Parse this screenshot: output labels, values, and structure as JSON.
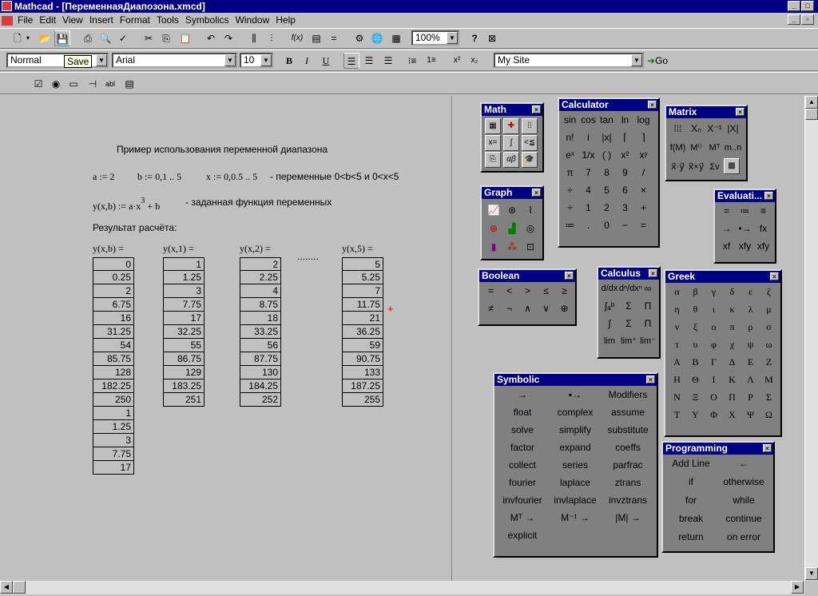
{
  "window": {
    "title": "Mathcad - [ПеременнаяДиапозона.xmcd]",
    "min": "_",
    "max": "□",
    "close": "×"
  },
  "menu": [
    "File",
    "Edit",
    "View",
    "Insert",
    "Format",
    "Tools",
    "Symbolics",
    "Window",
    "Help"
  ],
  "toolbar": {
    "zoom": "100%",
    "save_tooltip": "Save"
  },
  "format_bar": {
    "style": "Normal",
    "font": "Arial",
    "size": "10",
    "bold": "B",
    "italic": "I",
    "underline": "U",
    "url": "My Site",
    "go": "Go"
  },
  "worksheet": {
    "heading": "Пример использования переменной диапазона",
    "defs": {
      "a": "a := 2",
      "b": "b := 0,1 .. 5",
      "x": "x := 0,0.5 .. 5",
      "note": "- переменные 0<b<5 и 0<x<5"
    },
    "func": {
      "lhs": "y(x,b) := a·x",
      "exp": "3",
      "rhs": "+ b",
      "note": "- заданная функция переменных"
    },
    "result_label": "Результат расчёта:",
    "dots": "........",
    "columns": [
      {
        "header": "y(x,b) =",
        "values": [
          "0",
          "0.25",
          "2",
          "6.75",
          "16",
          "31.25",
          "54",
          "85.75",
          "128",
          "182.25",
          "250",
          "1",
          "1.25",
          "3",
          "7.75",
          "17"
        ]
      },
      {
        "header": "y(x,1) =",
        "values": [
          "1",
          "1.25",
          "3",
          "7.75",
          "17",
          "32.25",
          "55",
          "86.75",
          "129",
          "183.25",
          "251"
        ]
      },
      {
        "header": "y(x,2) =",
        "values": [
          "2",
          "2.25",
          "4",
          "8.75",
          "18",
          "33.25",
          "56",
          "87.75",
          "130",
          "184.25",
          "252"
        ]
      },
      {
        "header": "y(x,5) =",
        "values": [
          "5",
          "5.25",
          "7",
          "11.75",
          "21",
          "36.25",
          "59",
          "90.75",
          "133",
          "187.25",
          "255"
        ]
      }
    ]
  },
  "palettes": {
    "math": {
      "title": "Math"
    },
    "calculator": {
      "title": "Calculator",
      "keys": [
        "sin",
        "cos",
        "tan",
        "ln",
        "log",
        "n!",
        "i",
        "|x|",
        "⌈",
        "⌉",
        "eˣ",
        "1/x",
        "( )",
        "x²",
        "xʸ",
        "π",
        "7",
        "8",
        "9",
        "/",
        "÷",
        "4",
        "5",
        "6",
        "×",
        "÷",
        "1",
        "2",
        "3",
        "+",
        "≔",
        ".",
        "0",
        "−",
        "="
      ]
    },
    "matrix": {
      "title": "Matrix"
    },
    "graph": {
      "title": "Graph"
    },
    "evaluation": {
      "title": "Evaluati...",
      "keys": [
        "=",
        "≔",
        "≡",
        "→",
        "•→",
        "fx",
        "xf",
        "xfy",
        "xfy"
      ]
    },
    "boolean": {
      "title": "Boolean",
      "keys": [
        "=",
        "<",
        ">",
        "≤",
        "≥",
        "≠",
        "¬",
        "∧",
        "∨",
        "⊕"
      ]
    },
    "calculus": {
      "title": "Calculus"
    },
    "greek": {
      "title": "Greek",
      "keys": [
        "α",
        "β",
        "γ",
        "δ",
        "ε",
        "ζ",
        "η",
        "θ",
        "ι",
        "κ",
        "λ",
        "μ",
        "ν",
        "ξ",
        "ο",
        "π",
        "ρ",
        "σ",
        "τ",
        "υ",
        "φ",
        "χ",
        "ψ",
        "ω",
        "Α",
        "Β",
        "Γ",
        "Δ",
        "Ε",
        "Ζ",
        "Η",
        "Θ",
        "Ι",
        "Κ",
        "Λ",
        "Μ",
        "Ν",
        "Ξ",
        "Ο",
        "Π",
        "Ρ",
        "Σ",
        "Τ",
        "Υ",
        "Φ",
        "Χ",
        "Ψ",
        "Ω"
      ]
    },
    "symbolic": {
      "title": "Symbolic",
      "keys": [
        "→",
        "▪→",
        "Modifiers",
        "float",
        "complex",
        "assume",
        "solve",
        "simplify",
        "substitute",
        "factor",
        "expand",
        "coeffs",
        "collect",
        "series",
        "parfrac",
        "fourier",
        "laplace",
        "ztrans",
        "invfourier",
        "invlaplace",
        "invztrans",
        "Mᵀ →",
        "M⁻¹ →",
        "|M| →",
        "explicit",
        "",
        ""
      ]
    },
    "programming": {
      "title": "Programming",
      "keys": [
        "Add Line",
        "←",
        "if",
        "otherwise",
        "for",
        "while",
        "break",
        "continue",
        "return",
        "on error"
      ]
    }
  }
}
